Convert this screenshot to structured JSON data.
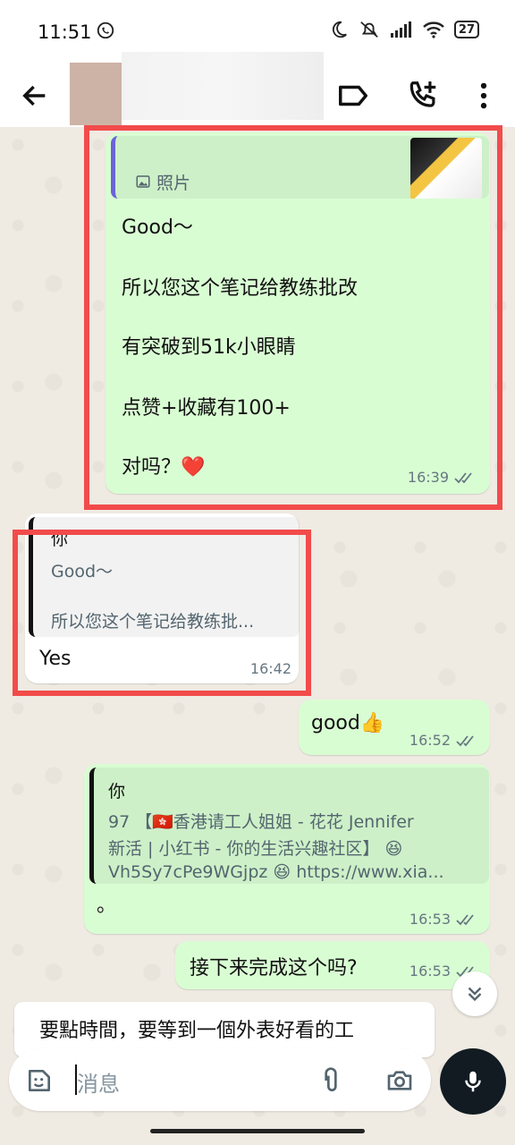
{
  "status_bar": {
    "time": "11:51",
    "battery": "27"
  },
  "messages": {
    "m1": {
      "quote_label": "照片",
      "lines": [
        "Good～",
        "所以您这个笔记给教练批改",
        "有突破到51k小眼睛",
        "点赞+收藏有100+",
        "对吗？❤️"
      ],
      "time": "16:39"
    },
    "m2": {
      "quote_author": "你",
      "quote_lines": [
        "Good～",
        "所以您这个笔记给教练批..."
      ],
      "text": "Yes",
      "time": "16:42"
    },
    "m3": {
      "text": "good👍",
      "time": "16:52"
    },
    "m4": {
      "quote_author": "你",
      "quote_lines": [
        "97 【🇭🇰香港请工人姐姐 - 花花 Jennifer",
        "新活 | 小红书 - 你的生活兴趣社区】 😆",
        "Vh5Sy7cPe9WGjpz 😆 https://www.xia..."
      ],
      "text": "。",
      "time": "16:53"
    },
    "m5": {
      "text": "接下来完成这个吗?",
      "time": "16:53"
    }
  },
  "preview_text": "要點時間，要等到一個外表好看的工",
  "input": {
    "placeholder": "消息"
  },
  "colors": {
    "outgoing": "#d9fdd3",
    "incoming": "#ffffff",
    "highlight": "#f24b4b",
    "quote_bar": "#6b63d9"
  }
}
